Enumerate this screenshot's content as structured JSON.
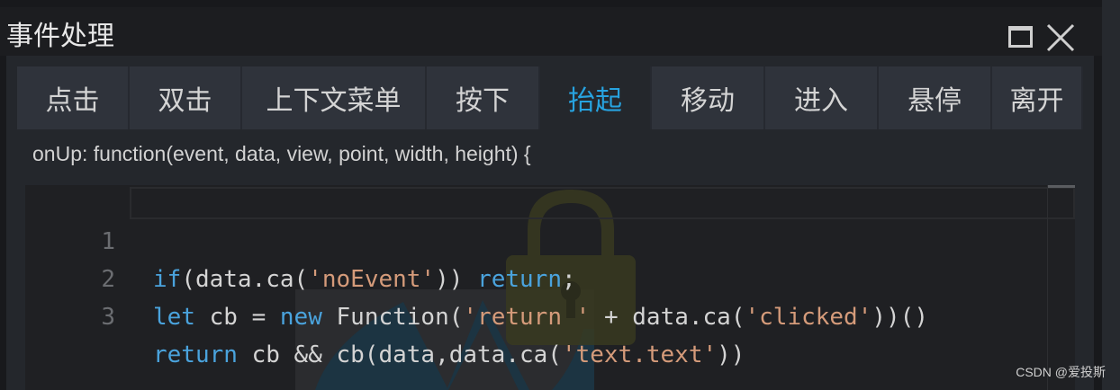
{
  "window": {
    "title": "事件处理"
  },
  "tabs": [
    {
      "label": "点击",
      "active": false
    },
    {
      "label": "双击",
      "active": false
    },
    {
      "label": "上下文菜单",
      "active": false
    },
    {
      "label": "按下",
      "active": false
    },
    {
      "label": "抬起",
      "active": true
    },
    {
      "label": "移动",
      "active": false
    },
    {
      "label": "进入",
      "active": false
    },
    {
      "label": "悬停",
      "active": false
    },
    {
      "label": "离开",
      "active": false
    }
  ],
  "editor": {
    "signature": "onUp: function(event, data, view, point, width, height) {",
    "line_numbers": [
      "1",
      "2",
      "3"
    ],
    "lines": [
      [
        {
          "t": "if",
          "k": "kw"
        },
        {
          "t": "(data.ca(",
          "k": ""
        },
        {
          "t": "'noEvent'",
          "k": "str"
        },
        {
          "t": ")) ",
          "k": ""
        },
        {
          "t": "return",
          "k": "kw"
        },
        {
          "t": ";",
          "k": ""
        }
      ],
      [
        {
          "t": "let",
          "k": "kw"
        },
        {
          "t": " cb = ",
          "k": ""
        },
        {
          "t": "new",
          "k": "kw"
        },
        {
          "t": " Function(",
          "k": ""
        },
        {
          "t": "'return '",
          "k": "str"
        },
        {
          "t": " + data.ca(",
          "k": ""
        },
        {
          "t": "'clicked'",
          "k": "str"
        },
        {
          "t": "))()",
          "k": ""
        }
      ],
      [
        {
          "t": "return",
          "k": "kw"
        },
        {
          "t": " cb && cb(data,data.ca(",
          "k": ""
        },
        {
          "t": "'text.text'",
          "k": "str"
        },
        {
          "t": "))",
          "k": ""
        }
      ]
    ]
  },
  "footer": {
    "watermark_text": "CSDN @爱投斯"
  },
  "colors": {
    "active_tab_text": "#27a3e0",
    "keyword": "#4aa3dd",
    "string": "#d59b7a"
  }
}
